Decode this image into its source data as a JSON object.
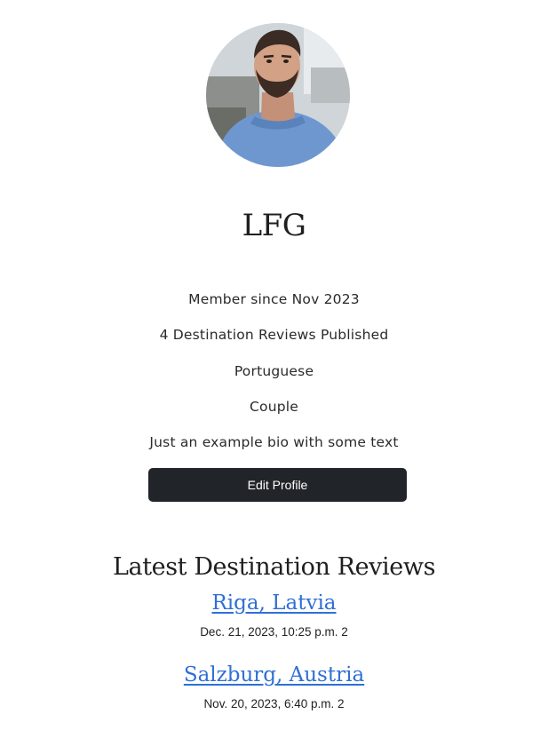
{
  "profile": {
    "username": "LFG",
    "member_since": "Member since Nov 2023",
    "reviews_published": "4 Destination Reviews Published",
    "nationality": "Portuguese",
    "travel_type": "Couple",
    "bio": "Just an example bio with some text",
    "edit_button_label": "Edit Profile"
  },
  "latest_reviews": {
    "title": "Latest Destination Reviews",
    "items": [
      {
        "destination": "Riga, Latvia",
        "meta": "Dec. 21, 2023, 10:25 p.m. 2"
      },
      {
        "destination": "Salzburg, Austria",
        "meta": "Nov. 20, 2023, 6:40 p.m. 2"
      }
    ]
  },
  "colors": {
    "link": "#2f6fd6",
    "button_bg": "#212529",
    "button_text": "#ffffff",
    "text": "#222222"
  }
}
